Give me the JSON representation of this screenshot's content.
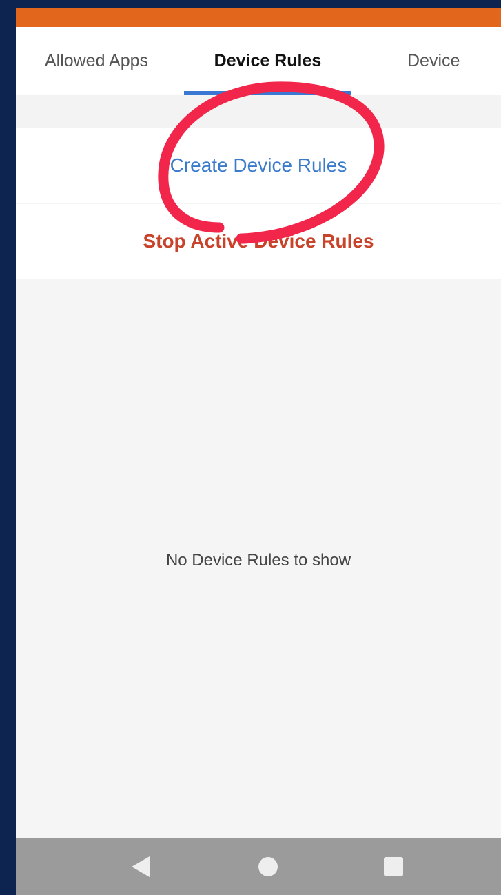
{
  "tabs": [
    {
      "label": "Allowed Apps",
      "selected": false
    },
    {
      "label": "Device Rules",
      "selected": true
    },
    {
      "label": "Device",
      "selected": false
    }
  ],
  "actions": {
    "create_label": "Create Device Rules",
    "stop_label": "Stop Active Device Rules"
  },
  "empty_state": {
    "message": "No Device Rules to show"
  },
  "navbar": {
    "back_icon": "back-triangle-icon",
    "home_icon": "home-circle-icon",
    "recent_icon": "recent-square-icon"
  },
  "colors": {
    "accent_orange": "#e2671d",
    "tab_indicator": "#3a78d4",
    "create_blue": "#3a7bcc",
    "stop_red": "#c9432a",
    "annotation_red": "#f1264a",
    "frame_navy": "#0d2350"
  }
}
